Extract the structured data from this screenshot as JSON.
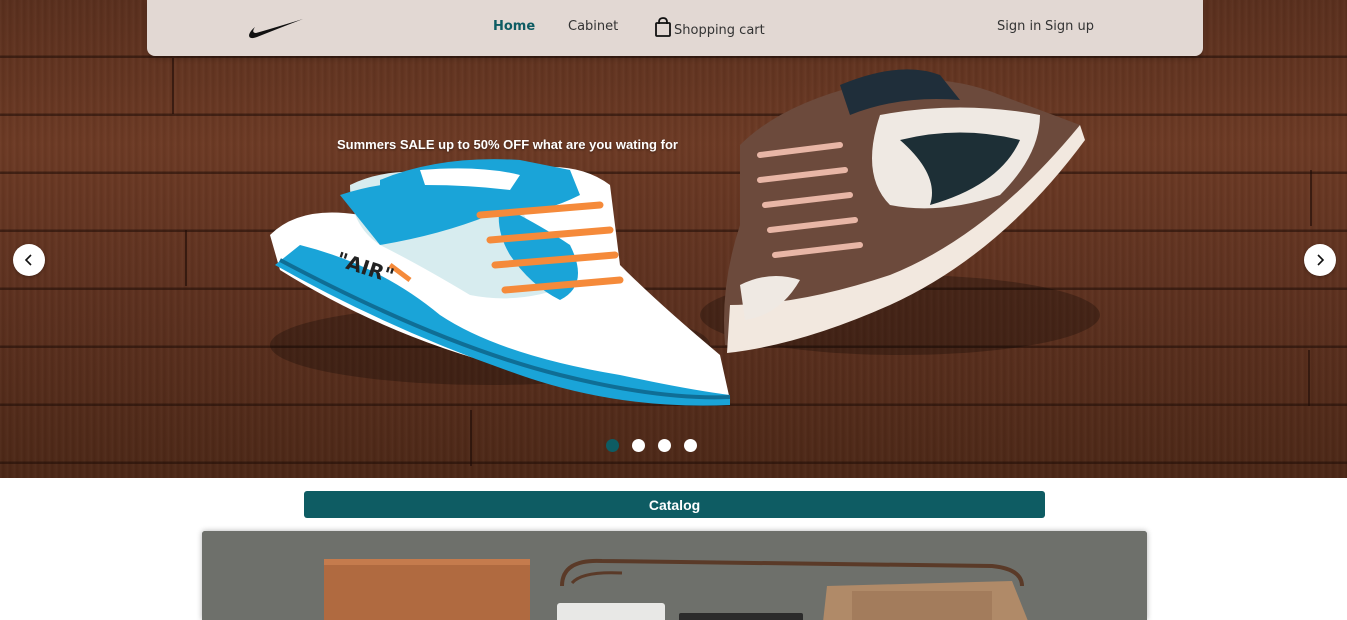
{
  "navbar": {
    "logo_icon": "nike-swoosh-icon",
    "links": {
      "home": "Home",
      "cabinet": "Cabinet",
      "cart": "Shopping cart",
      "sign_in": "Sign in",
      "sign_up": "Sign up"
    },
    "active_link": "Home",
    "cart_icon": "shopping-bag-icon"
  },
  "carousel": {
    "slide_text": "Summers SALE up to 50% OFF what are you wating for",
    "prev_icon": "chevron-left-icon",
    "next_icon": "chevron-right-icon",
    "slide_count": 4,
    "active_slide": 1
  },
  "catalog": {
    "title": "Catalog"
  },
  "colors": {
    "accent": "#0e5c63",
    "navbar_bg": "#e2d8d3"
  }
}
